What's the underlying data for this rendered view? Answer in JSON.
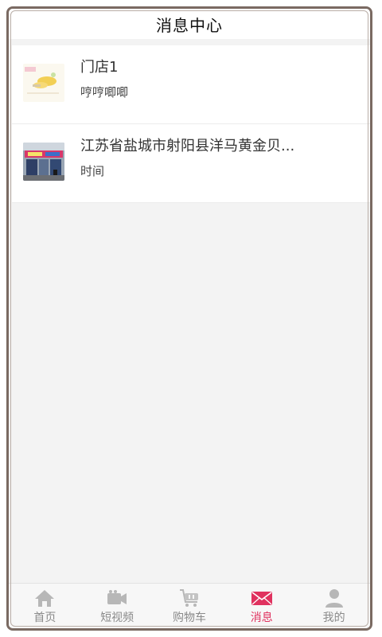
{
  "header": {
    "title": "消息中心"
  },
  "messages": [
    {
      "title": "门店1",
      "subtitle": "哼哼唧唧",
      "thumbnail_icon": "store-thumbnail"
    },
    {
      "title": "江苏省盐城市射阳县洋马黄金贝...",
      "subtitle": "时间",
      "thumbnail_icon": "storefront-photo"
    }
  ],
  "tabbar": {
    "items": [
      {
        "label": "首页",
        "icon": "home-icon",
        "active": false
      },
      {
        "label": "短视频",
        "icon": "video-camera-icon",
        "active": false
      },
      {
        "label": "购物车",
        "icon": "cart-icon",
        "active": false
      },
      {
        "label": "消息",
        "icon": "mail-icon",
        "active": true
      },
      {
        "label": "我的",
        "icon": "user-icon",
        "active": false
      }
    ]
  },
  "colors": {
    "accent": "#e0325f",
    "inactive": "#8a8a8a",
    "background": "#f3f3f3"
  }
}
